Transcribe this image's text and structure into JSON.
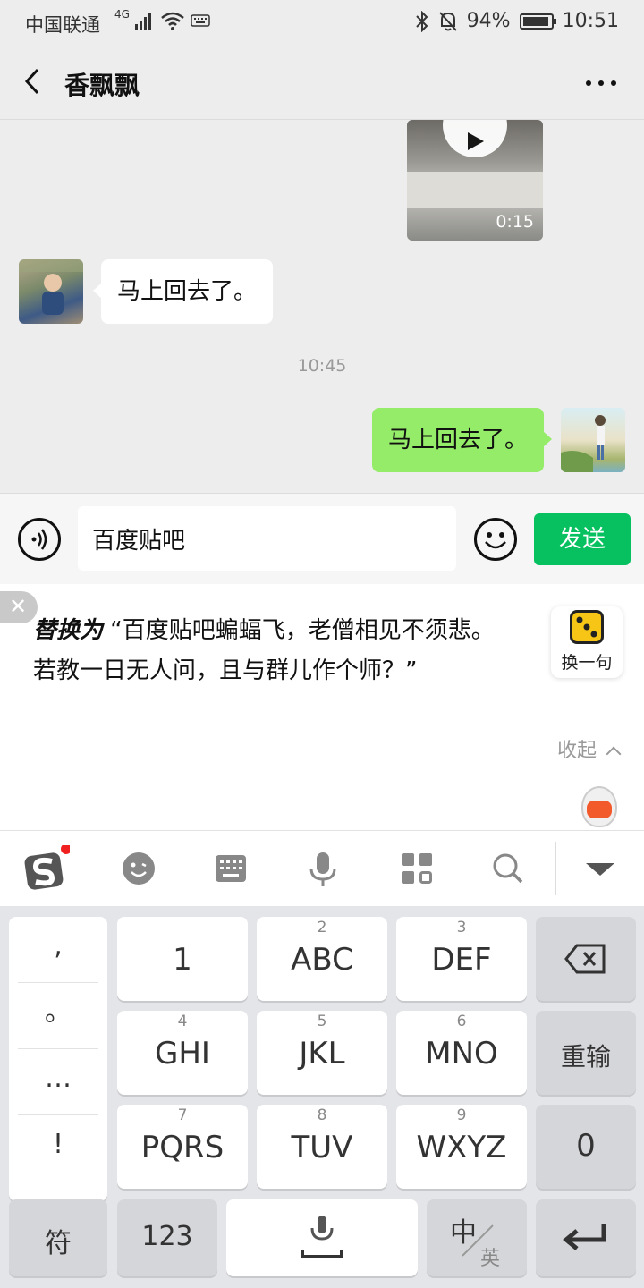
{
  "status_bar": {
    "carrier": "中国联通",
    "network": "4G",
    "battery": "94%",
    "battery_level": 0.94,
    "time": "10:51"
  },
  "nav": {
    "title": "香飘飘"
  },
  "chat": {
    "video_duration": "0:15",
    "incoming_message": "马上回去了。",
    "timestamp": "10:45",
    "outgoing_message": "马上回去了。"
  },
  "input_bar": {
    "text_value": "百度贴吧",
    "send_label": "发送"
  },
  "suggestion": {
    "prefix": "替换为",
    "text": "“百度贴吧蝙蝠飞，老僧相见不须悲。若教一日无人问，且与群儿作个师？”",
    "swap_label": "换一句",
    "collapse_label": "收起"
  },
  "keyboard": {
    "punctuation": [
      ",",
      "。",
      "…",
      "!"
    ],
    "keys": [
      {
        "num": "",
        "label": "1"
      },
      {
        "num": "2",
        "label": "ABC"
      },
      {
        "num": "3",
        "label": "DEF"
      },
      {
        "num": "4",
        "label": "GHI"
      },
      {
        "num": "5",
        "label": "JKL"
      },
      {
        "num": "6",
        "label": "MNO"
      },
      {
        "num": "7",
        "label": "PQRS"
      },
      {
        "num": "8",
        "label": "TUV"
      },
      {
        "num": "9",
        "label": "WXYZ"
      }
    ],
    "reinput_label": "重输",
    "zero_label": "0",
    "symbol_label": "符",
    "numeric_label": "123",
    "lang_zh": "中",
    "lang_en": "英"
  },
  "colors": {
    "accent_green": "#07c160",
    "bubble_green": "#95ec69"
  }
}
